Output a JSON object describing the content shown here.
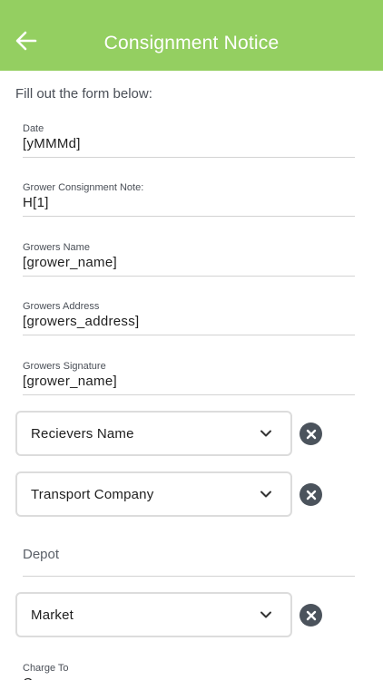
{
  "header": {
    "title": "Consignment Notice",
    "back_icon": "arrow-left-icon",
    "background": "#94cf61"
  },
  "form": {
    "intro": "Fill out the form below:",
    "fields": [
      {
        "label": "Date",
        "value": "[yMMMd]"
      },
      {
        "label": "Grower Consignment Note:",
        "value": "H[1]"
      },
      {
        "label": "Growers Name",
        "value": "[grower_name]"
      },
      {
        "label": "Growers Address",
        "value": "[growers_address]"
      },
      {
        "label": "Growers Signature",
        "value": "[grower_name]"
      }
    ],
    "dropdowns": [
      {
        "label": "Recievers Name"
      },
      {
        "label": "Transport Company"
      },
      {
        "label": "Market"
      }
    ],
    "depot": {
      "placeholder": "Depot"
    },
    "charge_to": {
      "label": "Charge To",
      "value": "C"
    }
  }
}
